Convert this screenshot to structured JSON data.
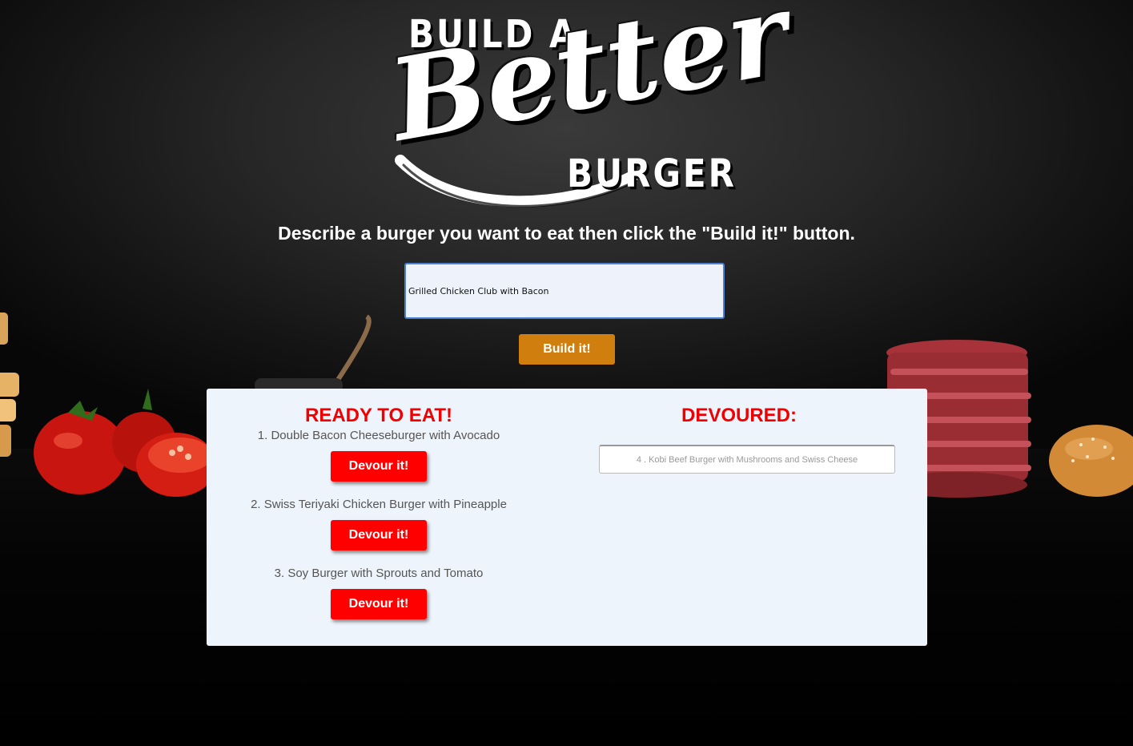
{
  "logo": {
    "top": "BUILD A",
    "script": "Better",
    "bottom": "BURGER"
  },
  "instruction": "Describe a burger you want to eat then click the \"Build it!\" button.",
  "form": {
    "input_value": "Grilled Chicken Club with Bacon",
    "build_button_label": "Build it!"
  },
  "ready": {
    "title": "READY TO EAT!",
    "items": [
      {
        "text": "1. Double Bacon Cheeseburger with Avocado",
        "button": "Devour it!"
      },
      {
        "text": "2. Swiss Teriyaki Chicken Burger with Pineapple",
        "button": "Devour it!"
      },
      {
        "text": "3. Soy Burger with Sprouts and Tomato",
        "button": "Devour it!"
      }
    ]
  },
  "devoured": {
    "title": "DEVOURED:",
    "items": [
      {
        "text": "4 . Kobi Beef Burger with Mushrooms and Swiss Cheese"
      }
    ]
  },
  "colors": {
    "accent_red": "#f00000",
    "devour_button": "#ff0000",
    "build_button": "#d07f0e",
    "panel_bg": "#eef4fb"
  }
}
